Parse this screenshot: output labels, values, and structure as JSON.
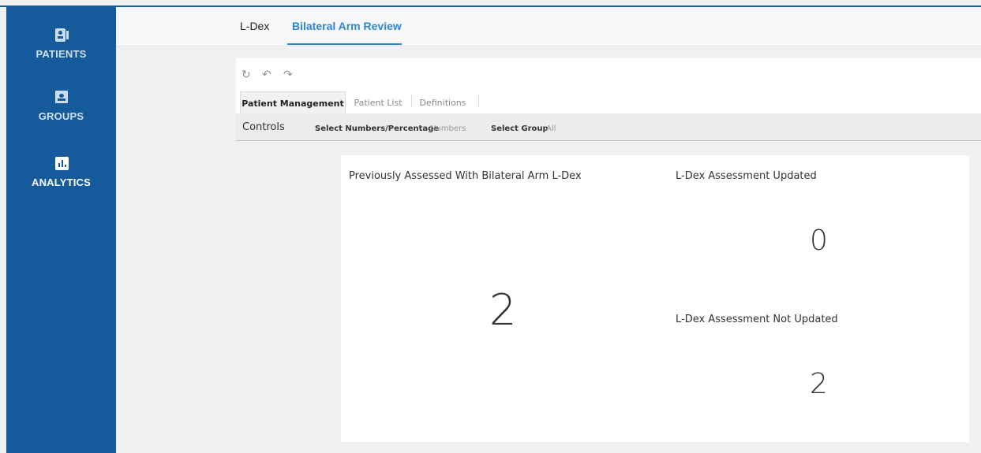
{
  "sidebar": {
    "items": [
      {
        "label": "PATIENTS",
        "icon": "patients-icon"
      },
      {
        "label": "GROUPS",
        "icon": "groups-icon"
      },
      {
        "label": "ANALYTICS",
        "icon": "analytics-icon",
        "active": true
      }
    ]
  },
  "header": {
    "tabs": [
      {
        "label": "L-Dex"
      },
      {
        "label": "Bilateral Arm Review",
        "active": true
      }
    ]
  },
  "toolbar": {
    "icons": [
      "refresh-icon",
      "undo-icon",
      "redo-icon"
    ],
    "sheet_tabs": [
      {
        "label": "Patient Management",
        "active": true
      },
      {
        "label": "Patient List"
      },
      {
        "label": "Definitions"
      }
    ]
  },
  "controls": {
    "title": "Controls",
    "numbers_label": "Select Numbers/Percentage",
    "numbers_value": "Numbers",
    "group_label": "Select Group",
    "group_value": "All"
  },
  "kpis": {
    "previously_assessed": {
      "title": "Previously Assessed With Bilateral Arm L-Dex",
      "value": "2"
    },
    "updated": {
      "title": "L-Dex Assessment Updated",
      "value": "0"
    },
    "not_updated": {
      "title": "L-Dex Assessment Not Updated",
      "value": "2"
    }
  },
  "colors": {
    "sidebar": "#155a9b",
    "accent": "#2b86d6"
  }
}
